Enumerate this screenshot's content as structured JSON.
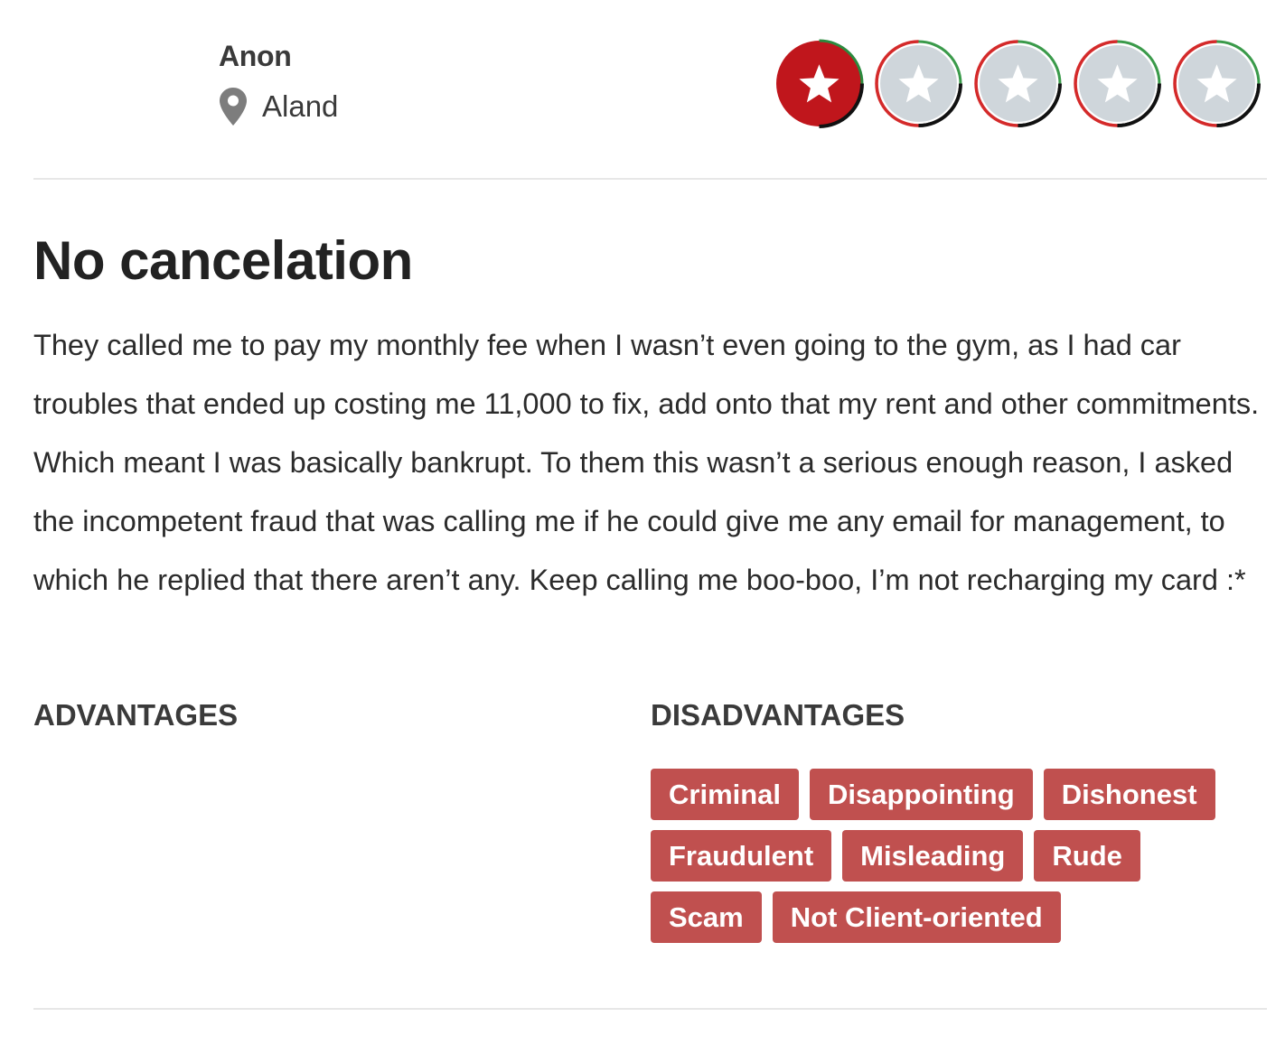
{
  "reviewer": {
    "name": "Anon",
    "location": "Aland",
    "location_icon": "map-pin-icon"
  },
  "rating": {
    "value": 1,
    "max": 5,
    "icon": "star-icon",
    "active_color": "#c0161c",
    "inactive_color": "#cfd6db"
  },
  "review": {
    "title": "No cancelation",
    "body": "They called me to pay my monthly fee when I wasn’t even going to the gym, as I had car troubles that ended up costing me 11,000 to fix, add onto that my rent and other commitments. Which meant I was basically bankrupt. To them this wasn’t a serious enough reason, I asked the incompetent fraud that was calling me if he could give me any email for management, to which he replied that there aren’t any. Keep calling me boo-boo, I’m not recharging my card :*"
  },
  "advantages": {
    "heading": "ADVANTAGES",
    "tags": []
  },
  "disadvantages": {
    "heading": "DISADVANTAGES",
    "tag_color": "#c0504f",
    "tags": [
      "Criminal",
      "Disappointing",
      "Dishonest",
      "Fraudulent",
      "Misleading",
      "Rude",
      "Scam",
      "Not Client-oriented"
    ]
  }
}
